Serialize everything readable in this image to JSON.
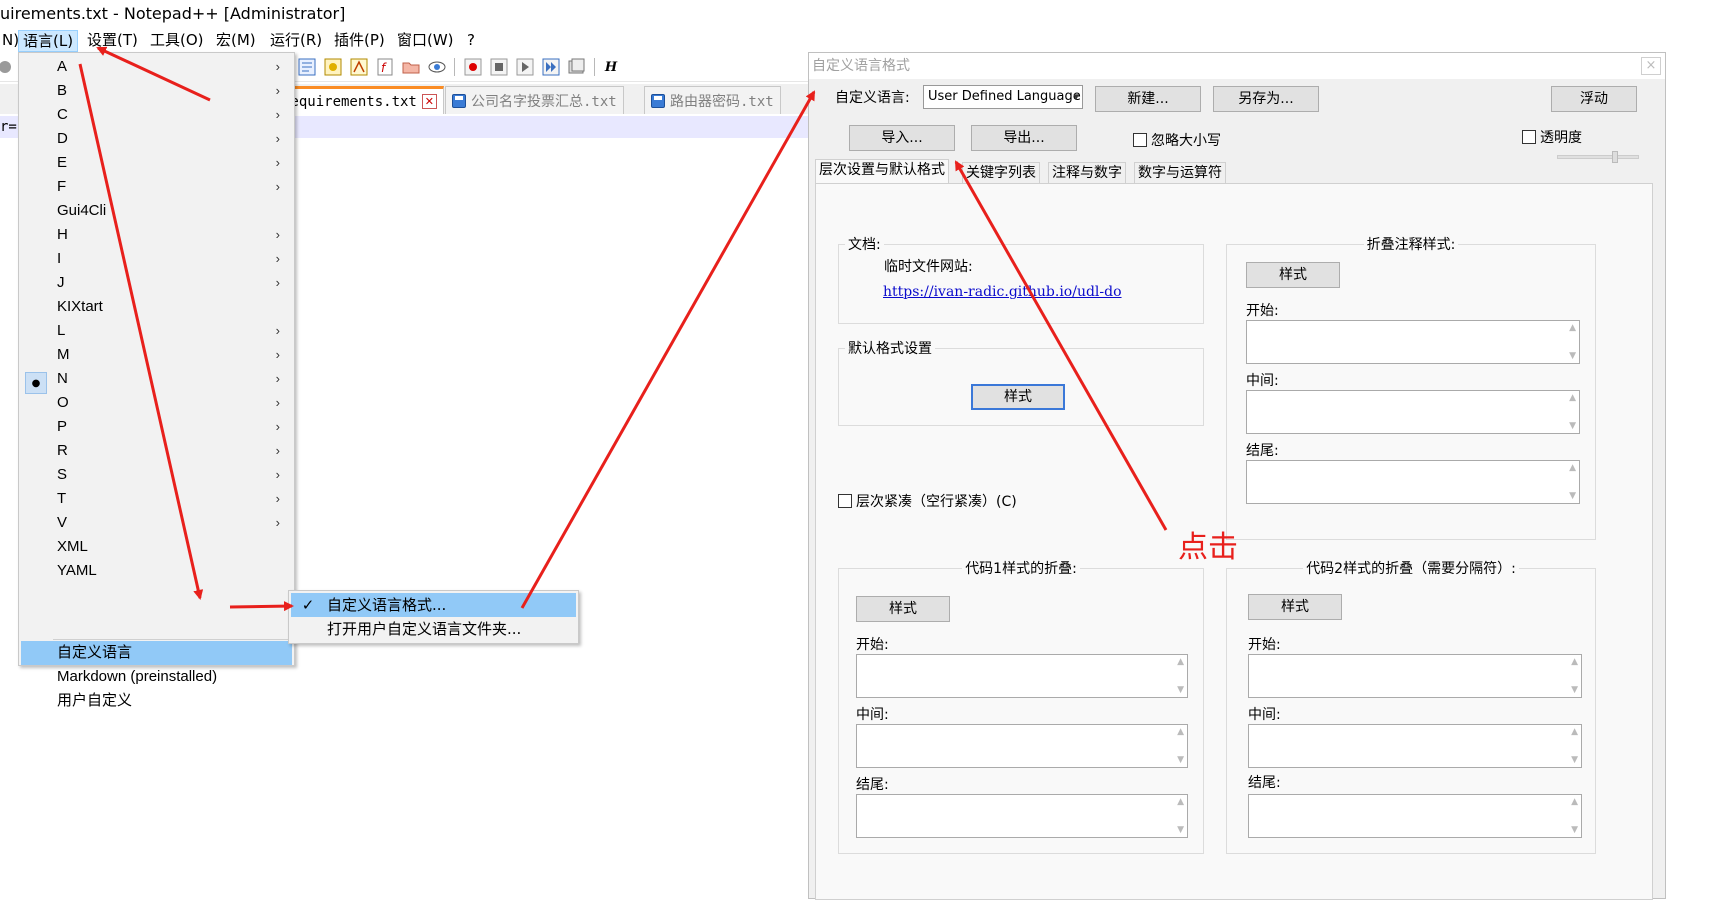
{
  "window": {
    "title": "uirements.txt - Notepad++ [Administrator]"
  },
  "menu": {
    "items": [
      "N)",
      "语言(L)",
      "设置(T)",
      "工具(O)",
      "宏(M)",
      "运行(R)",
      "插件(P)",
      "窗口(W)",
      "?"
    ]
  },
  "tabs": [
    {
      "label": "requirements.txt"
    },
    {
      "label": "公司名字投票汇总.txt"
    },
    {
      "label": "路由器密码.txt"
    }
  ],
  "editor": {
    "first_line": "r="
  },
  "language_menu": {
    "items": [
      "A",
      "B",
      "C",
      "D",
      "E",
      "F",
      "Gui4Cli",
      "H",
      "I",
      "J",
      "KIXtart",
      "L",
      "M",
      "N",
      "O",
      "P",
      "R",
      "S",
      "T",
      "V",
      "XML",
      "YAML"
    ],
    "current": "N",
    "udl_item": "自定义语言",
    "markdown_item": "Markdown (preinstalled)",
    "user_defined_item": "用户自定义"
  },
  "udl_submenu": {
    "items": [
      "自定义语言格式...",
      "打开用户自定义语言文件夹..."
    ]
  },
  "udl_dialog": {
    "title": "自定义语言格式",
    "close": "×",
    "lang_label": "自定义语言:",
    "lang_value": "User Defined Language",
    "new_btn": "新建...",
    "save_as_btn": "另存为...",
    "float_btn": "浮动",
    "import_btn": "导入...",
    "export_btn": "导出...",
    "ignore_case": "忽略大小写",
    "transparency": "透明度",
    "tabs": [
      "层次设置与默认格式",
      "关键字列表",
      "注释与数字",
      "数字与运算符"
    ],
    "doc_group": "文档:",
    "temp_site_label": "临时文件网站:",
    "temp_site_url": "https://ivan-radic.github.io/udl-do",
    "default_style_group": "默认格式设置",
    "style_btn": "样式",
    "compact_fold": "层次紧凑（空行紧凑）(C)",
    "comment_fold_group": "折叠注释样式:",
    "code1_group": "代码1样式的折叠:",
    "code2_group": "代码2样式的折叠（需要分隔符）:",
    "start_label": "开始:",
    "middle_label": "中间:",
    "end_label": "结尾:"
  },
  "annotation": {
    "click_text": "点击",
    "color": "#e8201c"
  }
}
